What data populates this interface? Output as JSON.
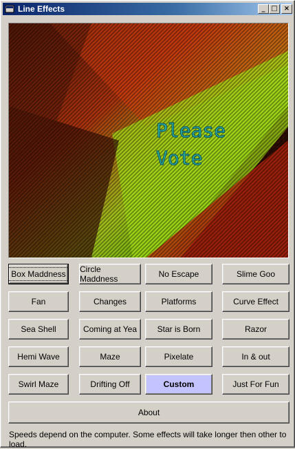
{
  "window": {
    "title": "Line Effects"
  },
  "titlebar_buttons": {
    "minimize": "_",
    "maximize": "□",
    "close": "×"
  },
  "canvas": {
    "text_line1": "Please",
    "text_line2": "Vote"
  },
  "buttons": {
    "box_maddness": "Box Maddness",
    "circle_maddness": "Circle Maddness",
    "no_escape": "No Escape",
    "slime_goo": "Slime Goo",
    "fan": "Fan",
    "changes": "Changes",
    "platforms": "Platforms",
    "curve_effect": "Curve Effect",
    "sea_shell": "Sea Shell",
    "coming_at_yea": "Coming at Yea",
    "star_is_born": "Star is Born",
    "razor": "Razor",
    "hemi_wave": "Hemi Wave",
    "maze": "Maze",
    "pixelate": "Pixelate",
    "in_and_out": "In & out",
    "swirl_maze": "Swirl Maze",
    "drifting_off": "Drifting Off",
    "custom": "Custom",
    "just_for_fun": "Just For Fun",
    "about": "About"
  },
  "status": "Speeds depend on the computer. Some effects will take longer then other to load.",
  "colors": {
    "custom_button": "#c3c3ff",
    "title_start": "#0a246a",
    "title_end": "#a6caf0"
  }
}
